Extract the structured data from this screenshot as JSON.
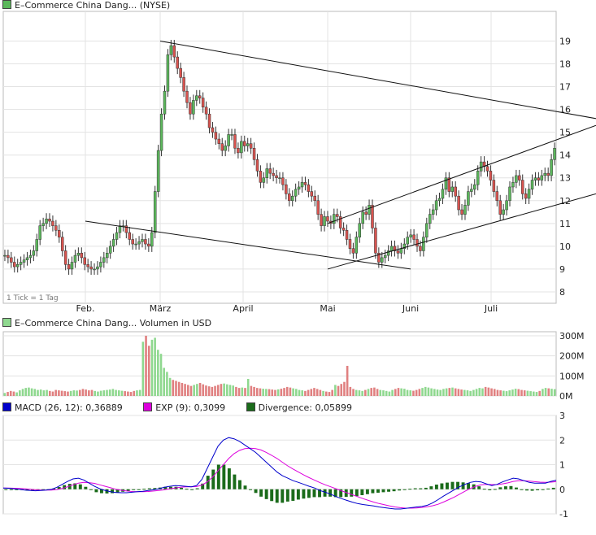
{
  "colors": {
    "up": "#5cb85c",
    "down": "#d9534f",
    "up_light": "#8fd88f",
    "down_light": "#e08080",
    "macd": "#0000cc",
    "exp": "#dd00dd",
    "div": "#1a6b1a",
    "grid": "#e3e3e3",
    "frame": "#bbbbbb"
  },
  "price_panel": {
    "legend": "E–Commerce China Dang... (NYSE)",
    "footnote": "1 Tick = 1 Tag"
  },
  "volume_panel": {
    "legend": "E–Commerce China Dang... Volumen in USD"
  },
  "macd_panel": {
    "macd_label": "MACD (26, 12): 0,36889",
    "exp_label": "EXP (9): 0,3099",
    "div_label": "Divergence: 0,05899"
  },
  "chart_data": [
    {
      "type": "candlestick",
      "title": "E–Commerce China Dang... (NYSE)",
      "x_tick_labels": [
        "Feb.",
        "März",
        "April",
        "Mai",
        "Juni",
        "Juli"
      ],
      "y_ticks": [
        8,
        9,
        10,
        11,
        12,
        13,
        14,
        15,
        16,
        17,
        18,
        19
      ],
      "ylim": [
        7.5,
        20.3
      ],
      "grid": true,
      "close": [
        9.6,
        9.5,
        9.3,
        9.1,
        9.2,
        9.3,
        9.4,
        9.5,
        9.6,
        9.8,
        10.3,
        10.9,
        11.0,
        11.2,
        11.1,
        10.9,
        10.7,
        10.4,
        9.8,
        9.2,
        9.0,
        9.3,
        9.6,
        9.7,
        9.5,
        9.2,
        9.1,
        9.0,
        9.0,
        9.1,
        9.3,
        9.5,
        9.7,
        10.0,
        10.3,
        10.6,
        10.9,
        10.9,
        10.6,
        10.3,
        10.1,
        10.1,
        10.2,
        10.3,
        10.1,
        10.0,
        10.6,
        12.4,
        14.2,
        15.8,
        16.8,
        18.4,
        18.8,
        18.3,
        17.8,
        17.4,
        16.8,
        16.3,
        15.8,
        16.4,
        16.6,
        16.5,
        16.1,
        15.8,
        15.2,
        15.0,
        14.7,
        14.5,
        14.2,
        14.4,
        14.9,
        14.9,
        14.3,
        14.1,
        14.6,
        14.4,
        14.5,
        14.3,
        13.8,
        13.3,
        12.8,
        13.0,
        13.4,
        13.2,
        13.1,
        13.0,
        13.0,
        12.7,
        12.3,
        12.0,
        12.2,
        12.5,
        12.6,
        12.8,
        12.7,
        12.4,
        12.2,
        12.0,
        11.4,
        10.9,
        11.3,
        11.1,
        11.0,
        11.4,
        11.3,
        10.8,
        10.7,
        10.3,
        9.9,
        9.7,
        10.4,
        11.0,
        11.5,
        11.4,
        11.8,
        10.8,
        9.7,
        9.3,
        9.5,
        9.6,
        9.8,
        10.0,
        9.8,
        9.7,
        9.9,
        10.1,
        10.4,
        10.5,
        10.3,
        10.0,
        9.8,
        10.4,
        11.0,
        11.4,
        11.6,
        12.0,
        12.1,
        12.5,
        13.0,
        12.4,
        12.6,
        12.2,
        11.6,
        11.4,
        11.8,
        12.4,
        12.5,
        12.7,
        13.3,
        13.7,
        13.5,
        13.3,
        12.9,
        12.4,
        12.0,
        11.4,
        11.6,
        12.0,
        12.6,
        12.8,
        13.1,
        12.9,
        12.3,
        12.1,
        12.5,
        12.9,
        13.0,
        12.9,
        13.1,
        13.2,
        13.1,
        13.8,
        14.3
      ],
      "candle_dir": "down",
      "trendlines": [
        {
          "from": [
            "März",
            19.0
          ],
          "to": [
            "end",
            15.6
          ]
        },
        {
          "from": [
            "Feb.",
            11.1
          ],
          "to": [
            "Juni",
            9.0
          ]
        },
        {
          "from": [
            "Mai",
            11.0
          ],
          "to": [
            "end",
            15.3
          ]
        },
        {
          "from": [
            "Mai",
            9.0
          ],
          "to": [
            "end",
            12.3
          ]
        }
      ]
    },
    {
      "type": "bar",
      "title": "Volumen in USD",
      "y_ticks": [
        "300M",
        "200M",
        "100M",
        "0M"
      ],
      "y_tick_values": [
        300,
        200,
        100,
        0
      ],
      "ylim": [
        0,
        320
      ],
      "values": [
        15,
        20,
        25,
        22,
        18,
        28,
        35,
        40,
        42,
        38,
        35,
        30,
        32,
        28,
        30,
        25,
        22,
        30,
        28,
        26,
        24,
        22,
        25,
        28,
        27,
        30,
        35,
        32,
        28,
        30,
        25,
        22,
        26,
        28,
        30,
        32,
        35,
        30,
        28,
        26,
        24,
        22,
        20,
        25,
        28,
        30,
        270,
        300,
        250,
        280,
        290,
        230,
        210,
        140,
        120,
        90,
        80,
        75,
        70,
        65,
        60,
        55,
        50,
        55,
        60,
        65,
        58,
        52,
        48,
        45,
        50,
        55,
        60,
        62,
        58,
        55,
        52,
        45,
        40,
        42,
        40,
        85,
        50,
        45,
        40,
        38,
        36,
        35,
        34,
        32,
        30,
        33,
        36,
        40,
        45,
        42,
        38,
        35,
        30,
        28,
        25,
        30,
        35,
        40,
        35,
        30,
        25,
        22,
        20,
        30,
        55,
        50,
        60,
        70,
        150,
        45,
        35,
        30,
        28,
        25,
        30,
        35,
        40,
        42,
        35,
        30,
        28,
        25,
        22,
        30,
        35,
        40,
        38,
        36,
        30,
        28,
        26,
        30,
        35,
        40,
        45,
        42,
        38,
        35,
        32,
        30,
        35,
        38,
        40,
        42,
        38,
        35,
        32,
        30,
        28,
        25,
        30,
        35,
        40,
        38,
        45,
        42,
        38,
        35,
        30,
        28,
        26,
        24,
        28,
        32,
        36,
        34,
        30,
        28,
        26,
        24,
        22,
        20,
        25,
        35,
        40,
        38,
        36,
        34
      ]
    },
    {
      "type": "line",
      "title": "MACD",
      "y_ticks": [
        3,
        2,
        1,
        0,
        -1
      ],
      "ylim": [
        -1,
        3
      ],
      "series": [
        {
          "name": "MACD (26, 12)",
          "values": [
            0.05,
            0.04,
            0.02,
            0.0,
            -0.03,
            -0.05,
            -0.06,
            -0.05,
            -0.03,
            0.0,
            0.08,
            0.2,
            0.32,
            0.42,
            0.45,
            0.38,
            0.25,
            0.12,
            0.02,
            -0.05,
            -0.1,
            -0.13,
            -0.14,
            -0.14,
            -0.12,
            -0.1,
            -0.08,
            -0.05,
            -0.02,
            0.02,
            0.08,
            0.12,
            0.15,
            0.14,
            0.12,
            0.1,
            0.15,
            0.4,
            0.85,
            1.3,
            1.75,
            2.0,
            2.1,
            2.05,
            1.95,
            1.8,
            1.65,
            1.5,
            1.3,
            1.1,
            0.9,
            0.7,
            0.55,
            0.45,
            0.35,
            0.28,
            0.2,
            0.12,
            0.05,
            -0.05,
            -0.12,
            -0.2,
            -0.3,
            -0.38,
            -0.45,
            -0.52,
            -0.58,
            -0.62,
            -0.65,
            -0.68,
            -0.72,
            -0.75,
            -0.78,
            -0.8,
            -0.8,
            -0.78,
            -0.75,
            -0.72,
            -0.7,
            -0.65,
            -0.55,
            -0.42,
            -0.28,
            -0.15,
            -0.02,
            0.1,
            0.2,
            0.28,
            0.32,
            0.3,
            0.22,
            0.15,
            0.2,
            0.3,
            0.38,
            0.45,
            0.42,
            0.35,
            0.28,
            0.25,
            0.25,
            0.25,
            0.32,
            0.37
          ]
        },
        {
          "name": "EXP (9)",
          "values": [
            0.05,
            0.05,
            0.04,
            0.03,
            0.02,
            0.0,
            -0.02,
            -0.03,
            -0.03,
            -0.03,
            -0.01,
            0.03,
            0.1,
            0.18,
            0.25,
            0.28,
            0.27,
            0.24,
            0.18,
            0.12,
            0.06,
            0.0,
            -0.04,
            -0.07,
            -0.09,
            -0.1,
            -0.1,
            -0.09,
            -0.07,
            -0.05,
            -0.02,
            0.02,
            0.05,
            0.08,
            0.1,
            0.1,
            0.11,
            0.17,
            0.3,
            0.5,
            0.75,
            1.0,
            1.25,
            1.45,
            1.58,
            1.65,
            1.67,
            1.65,
            1.6,
            1.5,
            1.38,
            1.25,
            1.1,
            0.95,
            0.82,
            0.7,
            0.58,
            0.47,
            0.37,
            0.27,
            0.18,
            0.1,
            0.02,
            -0.06,
            -0.14,
            -0.22,
            -0.3,
            -0.38,
            -0.45,
            -0.52,
            -0.58,
            -0.63,
            -0.68,
            -0.72,
            -0.75,
            -0.77,
            -0.77,
            -0.76,
            -0.74,
            -0.71,
            -0.67,
            -0.61,
            -0.52,
            -0.42,
            -0.32,
            -0.2,
            -0.08,
            0.03,
            0.12,
            0.18,
            0.2,
            0.19,
            0.19,
            0.22,
            0.26,
            0.32,
            0.35,
            0.35,
            0.33,
            0.31,
            0.29,
            0.28,
            0.29,
            0.31
          ]
        },
        {
          "name": "Divergence",
          "type": "bar",
          "values": [
            0,
            -0.01,
            -0.02,
            -0.03,
            -0.05,
            -0.05,
            -0.04,
            -0.02,
            0.0,
            0.03,
            0.09,
            0.17,
            0.22,
            0.24,
            0.2,
            0.1,
            -0.02,
            -0.12,
            -0.16,
            -0.17,
            -0.16,
            -0.13,
            -0.1,
            -0.07,
            -0.03,
            0.0,
            0.02,
            0.04,
            0.05,
            0.07,
            0.1,
            0.1,
            0.1,
            0.06,
            0.02,
            0.0,
            0.04,
            0.23,
            0.55,
            0.8,
            1.0,
            1.0,
            0.85,
            0.6,
            0.37,
            0.15,
            -0.02,
            -0.15,
            -0.3,
            -0.4,
            -0.48,
            -0.55,
            -0.55,
            -0.5,
            -0.47,
            -0.42,
            -0.38,
            -0.35,
            -0.32,
            -0.32,
            -0.3,
            -0.3,
            -0.32,
            -0.32,
            -0.31,
            -0.3,
            -0.28,
            -0.24,
            -0.2,
            -0.16,
            -0.14,
            -0.12,
            -0.1,
            -0.08,
            -0.05,
            -0.01,
            0.02,
            0.04,
            0.04,
            0.06,
            0.12,
            0.19,
            0.24,
            0.27,
            0.3,
            0.3,
            0.28,
            0.25,
            0.2,
            0.12,
            0.02,
            -0.04,
            0.01,
            0.08,
            0.12,
            0.13,
            0.07,
            0.0,
            -0.05,
            -0.06,
            -0.04,
            -0.03,
            0.03,
            0.06
          ]
        }
      ]
    }
  ]
}
